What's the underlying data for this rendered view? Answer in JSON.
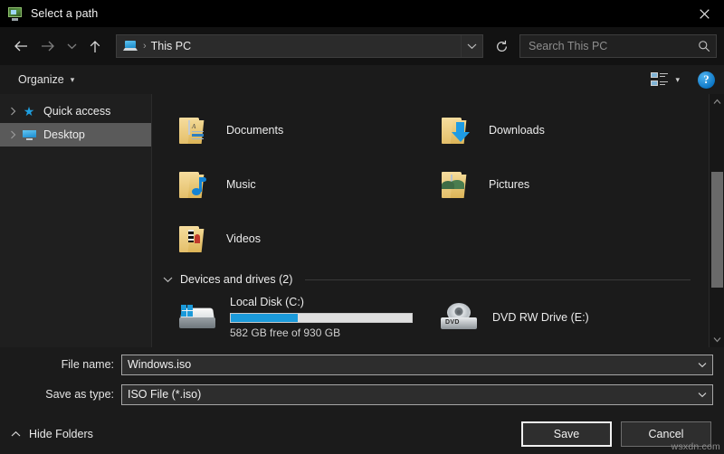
{
  "window": {
    "title": "Select a path",
    "title_icon": "app-monitor-icon",
    "close_label": "✕"
  },
  "nav": {
    "back_title": "Back",
    "forward_title": "Forward",
    "recent_title": "Recent locations",
    "up_title": "Up",
    "breadcrumb_icon": "this-pc-icon",
    "breadcrumb": "This PC",
    "separator": "›",
    "refresh_title": "Refresh",
    "dropdown_title": "Previous locations"
  },
  "search": {
    "placeholder": "Search This PC",
    "icon": "search-icon"
  },
  "toolbar": {
    "organize_label": "Organize",
    "organize_caret": "▾",
    "view_icon": "view-mode-icon",
    "view_caret": "▾",
    "help_label": "?"
  },
  "sidebar": {
    "items": [
      {
        "label": "Quick access",
        "icon": "star-icon",
        "active": false
      },
      {
        "label": "Desktop",
        "icon": "monitor-icon",
        "active": true
      }
    ]
  },
  "files": {
    "folders": [
      {
        "label": "Documents",
        "icon": "folder-documents-icon"
      },
      {
        "label": "Downloads",
        "icon": "folder-downloads-icon"
      },
      {
        "label": "Music",
        "icon": "folder-music-icon"
      },
      {
        "label": "Pictures",
        "icon": "folder-pictures-icon"
      },
      {
        "label": "Videos",
        "icon": "folder-videos-icon"
      }
    ],
    "group": {
      "title": "Devices and drives (2)",
      "chevron": "collapse-chevron-icon"
    },
    "drives": [
      {
        "name": "Local Disk (C:)",
        "icon": "hard-drive-icon",
        "usage_text": "582 GB free of 930 GB",
        "free": "582 GB",
        "total": "930 GB",
        "used_percent": 37,
        "bar_color": "#1b9ada"
      },
      {
        "name": "DVD RW Drive (E:)",
        "icon": "dvd-drive-icon",
        "badge": "DVD"
      }
    ]
  },
  "form": {
    "filename_label": "File name:",
    "filename_value": "Windows.iso",
    "filetype_label": "Save as type:",
    "filetype_value": "ISO File (*.iso)"
  },
  "footer": {
    "hide_folders_label": "Hide Folders",
    "hide_folders_chevron": "chevron-up-icon",
    "save_label": "Save",
    "cancel_label": "Cancel"
  },
  "watermark": "wsxdn.com"
}
